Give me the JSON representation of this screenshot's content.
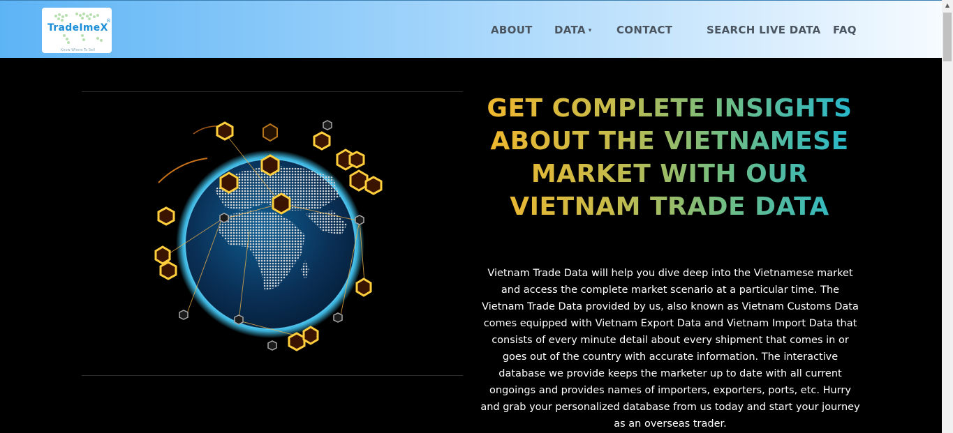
{
  "logo": {
    "text": "TradeImeX",
    "registered_mark": "®",
    "tagline": "Know Where To Sell"
  },
  "nav": {
    "items": [
      {
        "label": "ABOUT"
      },
      {
        "label": "DATA",
        "has_dropdown": true,
        "caret": "▾"
      },
      {
        "label": "CONTACT"
      },
      {
        "label": "SEARCH LIVE DATA"
      },
      {
        "label": "FAQ"
      }
    ]
  },
  "hero": {
    "headline": "GET COMPLETE INSIGHTS ABOUT THE VIETNAMESE MARKET WITH OUR VIETNAM TRADE DATA",
    "paragraph": "Vietnam Trade Data will help you dive deep into the Vietnamese market and access the complete market scenario at a particular time. The Vietnam Trade Data provided by us, also known as Vietnam Customs Data comes equipped with Vietnam Export Data and Vietnam Import Data that consists of every minute detail about every shipment that comes in or goes out of the country with accurate information. The interactive database we provide keeps the marketer up to date with all current ongoings and provides names of importers, exporters, ports, etc. Hurry and grab your personalized database from us today and start your journey as an overseas trader.",
    "image_icons": [
      "globe-icon",
      "hexagon-node-icon"
    ]
  },
  "colors": {
    "header_gradient_start": "#5db4f5",
    "header_gradient_end": "#f6fbff",
    "nav_text": "#4a5560",
    "headline_gradient": [
      "#f2b72c",
      "#c7bb4b",
      "#6fbd85",
      "#23b7cf"
    ],
    "hero_background": "#000000",
    "paragraph_text": "#ffffff",
    "logo_text": "#1c8fd8"
  },
  "scrollbar": {
    "up_arrow": "▲"
  }
}
